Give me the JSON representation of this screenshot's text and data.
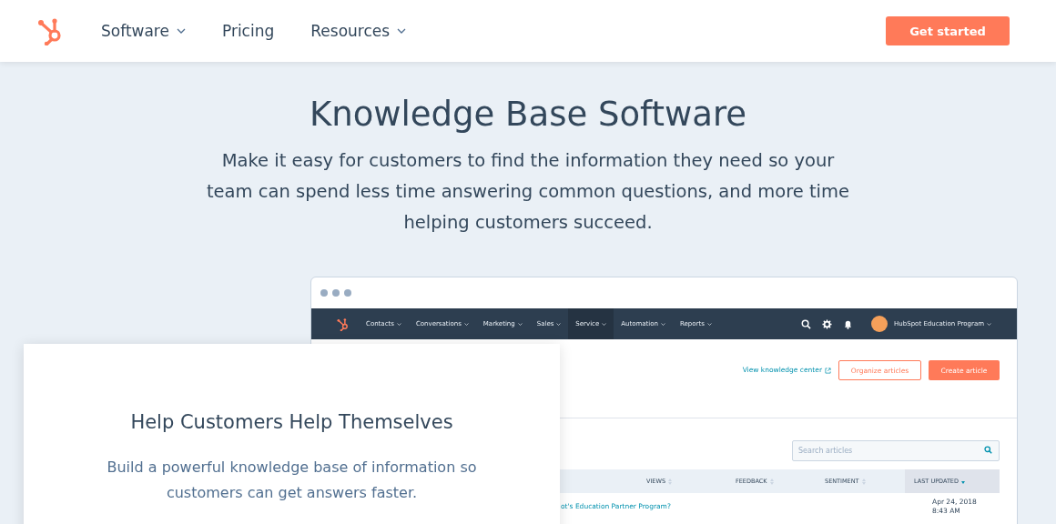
{
  "header": {
    "nav": [
      {
        "label": "Software",
        "dropdown": true
      },
      {
        "label": "Pricing",
        "dropdown": false
      },
      {
        "label": "Resources",
        "dropdown": true
      }
    ],
    "cta": "Get started"
  },
  "hero": {
    "title": "Knowledge Base Software",
    "subtitle": "Make it easy for customers to find the information they need so your team can spend less time answering common questions, and more time helping customers succeed."
  },
  "app_screenshot": {
    "nav": [
      {
        "label": "Contacts",
        "selected": false
      },
      {
        "label": "Conversations",
        "selected": false
      },
      {
        "label": "Marketing",
        "selected": false
      },
      {
        "label": "Sales",
        "selected": false
      },
      {
        "label": "Service",
        "selected": true
      },
      {
        "label": "Automation",
        "selected": false
      },
      {
        "label": "Reports",
        "selected": false
      }
    ],
    "account": "HubSpot Education Program",
    "view_link": "View knowledge center",
    "organize_button": "Organize articles",
    "create_button": "Create article",
    "search": {
      "placeholder": "Search articles"
    },
    "columns": [
      {
        "label": "VIEWS",
        "selected": false
      },
      {
        "label": "FEEDBACK",
        "selected": false
      },
      {
        "label": "SENTIMENT",
        "selected": false
      },
      {
        "label": "LAST UPDATED",
        "selected": true
      }
    ],
    "rows": [
      {
        "title": "ot's Education Partner Program?",
        "updated": "Apr 24, 2018 8:43 AM"
      }
    ]
  },
  "feature_card": {
    "title": "Help Customers Help Themselves",
    "text": "Build a powerful knowledge base of information so customers can get answers faster."
  }
}
